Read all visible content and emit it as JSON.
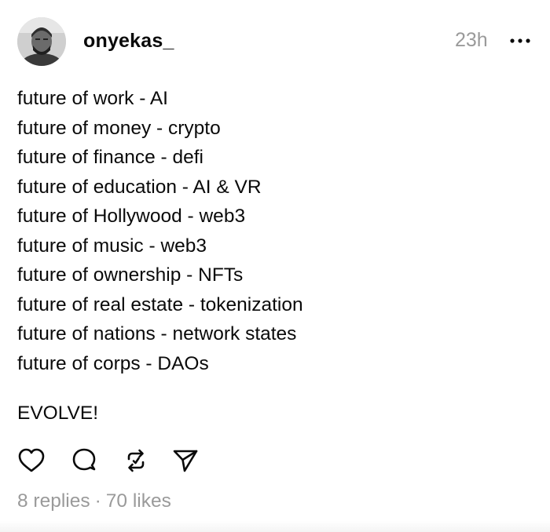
{
  "post": {
    "author": {
      "username": "onyekas_",
      "avatar_icon": "avatar-photo"
    },
    "timestamp": "23h",
    "more_icon": "more-horizontal-icon",
    "lines": [
      "future of work - AI",
      "future of money - crypto",
      "future of finance - defi",
      "future of education - AI & VR",
      "future of Hollywood - web3",
      "future of music - web3",
      "future of ownership - NFTs",
      "future of real estate - tokenization",
      "future of nations - network states",
      "future of corps - DAOs"
    ],
    "closing": "EVOLVE!",
    "actions": [
      "heart-icon",
      "comment-icon",
      "repost-icon",
      "share-icon"
    ],
    "stats": {
      "replies": "8 replies",
      "separator": "·",
      "likes": "70 likes"
    }
  }
}
